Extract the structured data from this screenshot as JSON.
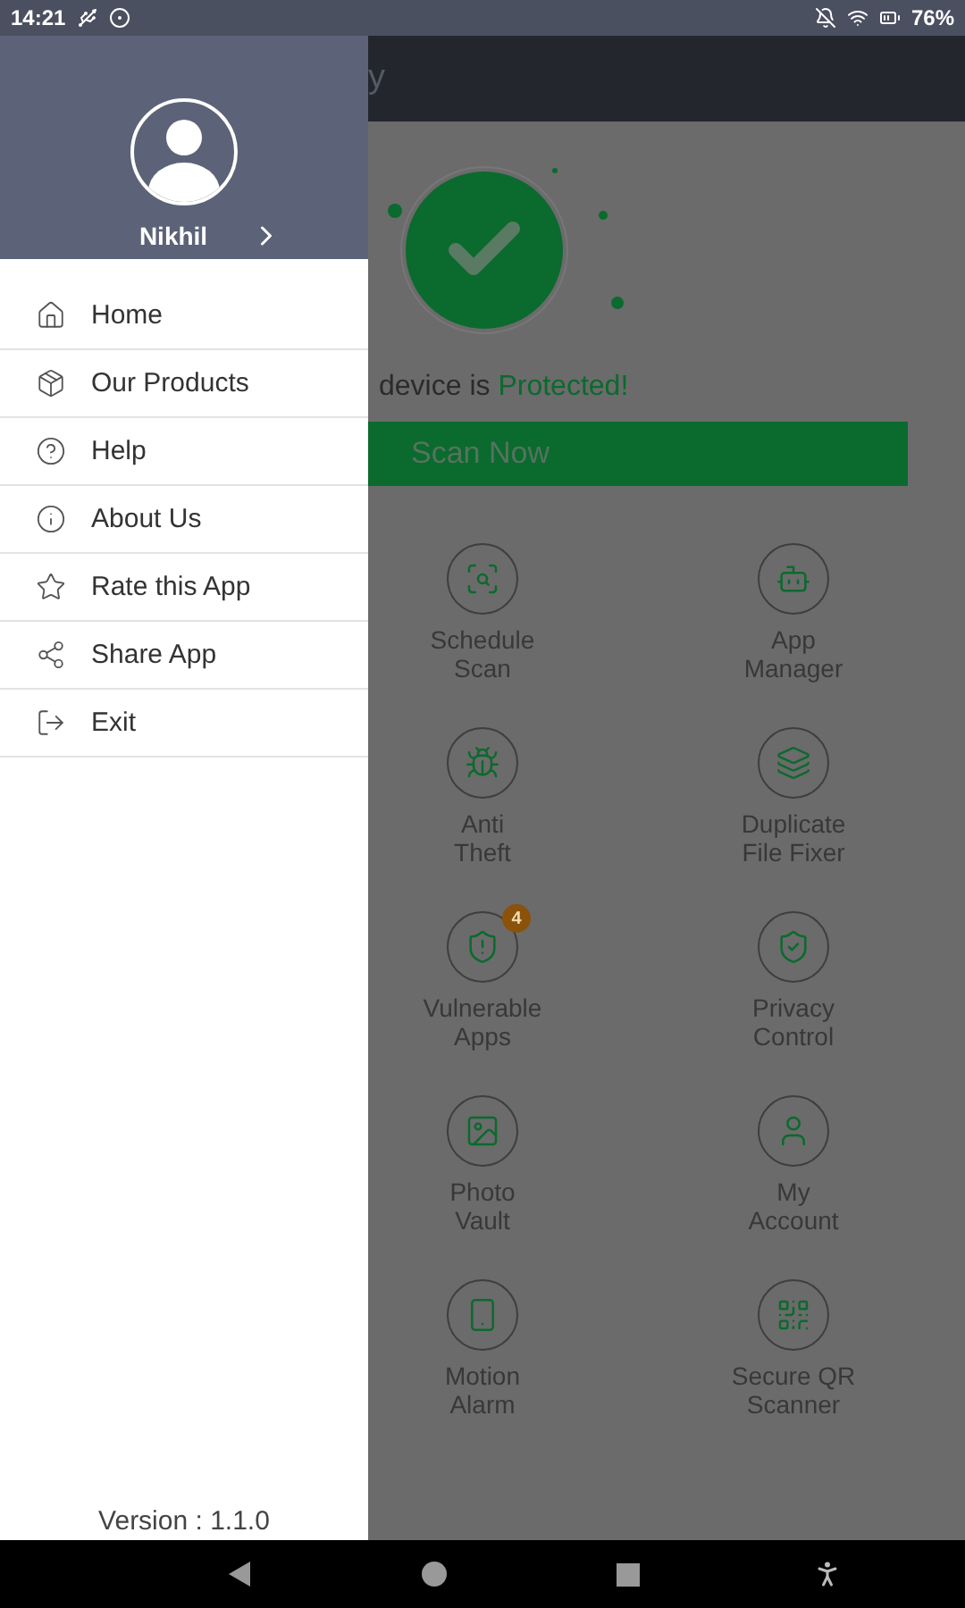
{
  "status_bar": {
    "time": "14:21",
    "battery": "76%"
  },
  "app_bar": {
    "title_fragment": "y"
  },
  "drawer": {
    "user_name": "Nikhil",
    "items": [
      {
        "label": "Home"
      },
      {
        "label": "Our Products"
      },
      {
        "label": "Help"
      },
      {
        "label": "About Us"
      },
      {
        "label": "Rate this App"
      },
      {
        "label": "Share App"
      },
      {
        "label": "Exit"
      }
    ],
    "version": "Version : 1.1.0"
  },
  "main": {
    "status_prefix": "device is ",
    "status_highlight": "Protected!",
    "scan_button": "Scan Now",
    "features": [
      {
        "lines": [
          "Schedule",
          "Scan"
        ]
      },
      {
        "lines": [
          "App",
          "Manager"
        ]
      },
      {
        "lines": [
          "Anti",
          "Theft"
        ]
      },
      {
        "lines": [
          "Duplicate",
          "File Fixer"
        ]
      },
      {
        "lines": [
          "Vulnerable",
          "Apps"
        ],
        "badge": "4"
      },
      {
        "lines": [
          "Privacy",
          "Control"
        ]
      },
      {
        "lines": [
          "Photo",
          "Vault"
        ]
      },
      {
        "lines": [
          "My",
          "Account"
        ]
      },
      {
        "lines": [
          "Motion",
          "Alarm"
        ]
      },
      {
        "lines": [
          "Secure QR",
          "Scanner"
        ]
      }
    ]
  }
}
